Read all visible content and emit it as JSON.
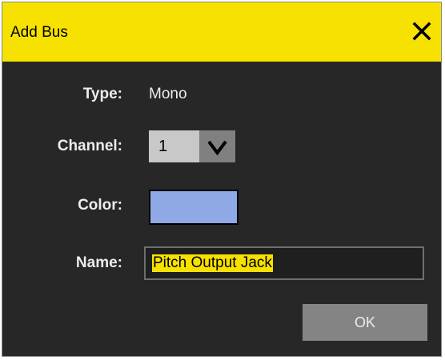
{
  "dialog": {
    "title": "Add Bus",
    "title_bg_color": "#f7e100",
    "body_bg_color": "#272727",
    "close_icon": "close-icon"
  },
  "form": {
    "type_label": "Type:",
    "type_value": "Mono",
    "channel_label": "Channel:",
    "channel_value": "1",
    "channel_dropdown_icon": "chevron-down-icon",
    "color_label": "Color:",
    "color_value": "#8fa9e6",
    "name_label": "Name:",
    "name_value": "Pitch Output Jack",
    "name_selected": true
  },
  "actions": {
    "ok_label": "OK"
  }
}
